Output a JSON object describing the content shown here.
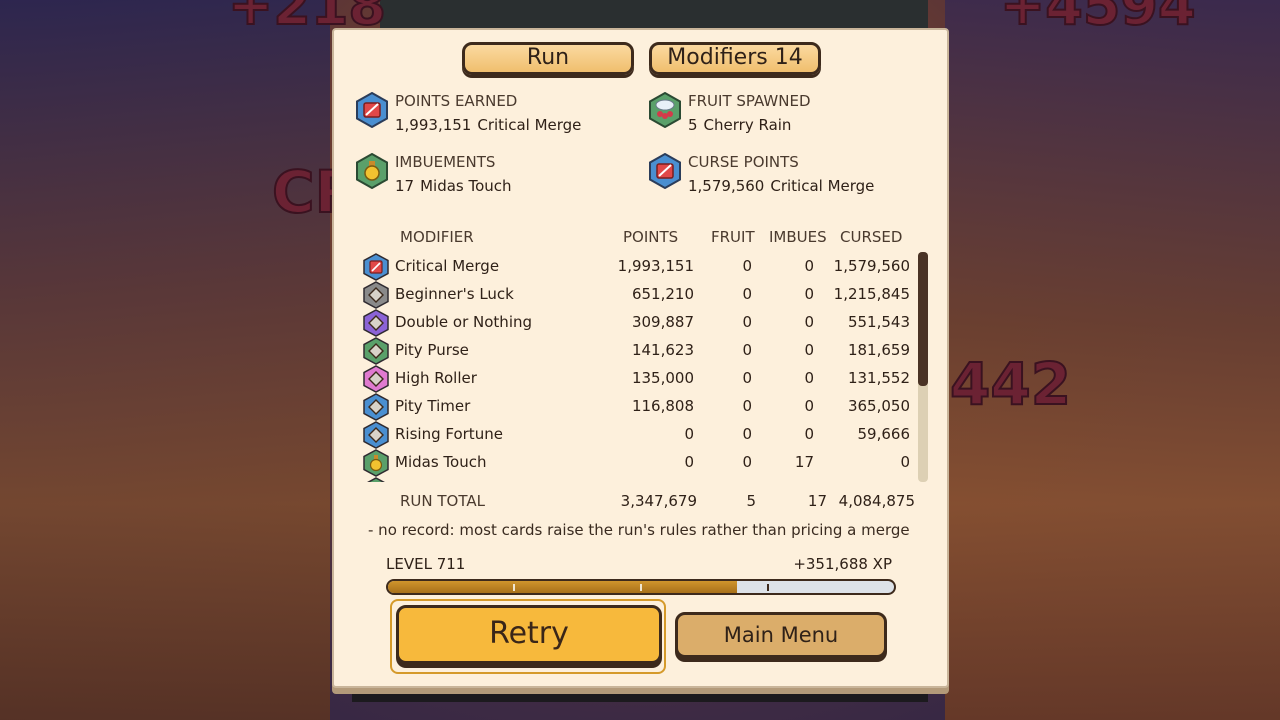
{
  "background": {
    "top_left_text": "+218",
    "top_right_text": "+4594",
    "left_text": "CR",
    "right_text": "442"
  },
  "tabs": {
    "run_label": "Run",
    "modifiers_label": "Modifiers  14"
  },
  "stats": {
    "points_earned": {
      "label": "POINTS EARNED",
      "value": "1,993,151",
      "source": "Critical Merge",
      "icon": "sword-blue-hex-icon"
    },
    "fruit_spawned": {
      "label": "FRUIT SPAWNED",
      "value": "5",
      "source": "Cherry Rain",
      "icon": "cherry-cloud-green-hex-icon"
    },
    "imbuements": {
      "label": "IMBUEMENTS",
      "value": "17",
      "source": "Midas Touch",
      "icon": "potion-green-hex-icon"
    },
    "curse_points": {
      "label": "CURSE POINTS",
      "value": "1,579,560",
      "source": "Critical Merge",
      "icon": "sword-blue-hex-icon"
    }
  },
  "table": {
    "headers": {
      "modifier": "MODIFIER",
      "points": "POINTS",
      "fruit": "FRUIT",
      "imbues": "IMBUES",
      "cursed": "CURSED"
    },
    "rows": [
      {
        "name": "Critical Merge",
        "points": "1,993,151",
        "fruit": "0",
        "imbues": "0",
        "cursed": "1,579,560",
        "icon": "sword-icon",
        "color": "#4a8fd1"
      },
      {
        "name": "Beginner's Luck",
        "points": "651,210",
        "fruit": "0",
        "imbues": "0",
        "cursed": "1,215,845",
        "icon": "diamond-icon",
        "color": "#8a8a8a"
      },
      {
        "name": "Double or Nothing",
        "points": "309,887",
        "fruit": "0",
        "imbues": "0",
        "cursed": "551,543",
        "icon": "diamond-icon",
        "color": "#8b63d6"
      },
      {
        "name": "Pity Purse",
        "points": "141,623",
        "fruit": "0",
        "imbues": "0",
        "cursed": "181,659",
        "icon": "diamond-icon",
        "color": "#5aa06a"
      },
      {
        "name": "High Roller",
        "points": "135,000",
        "fruit": "0",
        "imbues": "0",
        "cursed": "131,552",
        "icon": "diamond-icon",
        "color": "#e07ad0"
      },
      {
        "name": "Pity Timer",
        "points": "116,808",
        "fruit": "0",
        "imbues": "0",
        "cursed": "365,050",
        "icon": "diamond-icon",
        "color": "#4a8fd1"
      },
      {
        "name": "Rising Fortune",
        "points": "0",
        "fruit": "0",
        "imbues": "0",
        "cursed": "59,666",
        "icon": "diamond-icon",
        "color": "#4a8fd1"
      },
      {
        "name": "Midas Touch",
        "points": "0",
        "fruit": "0",
        "imbues": "17",
        "cursed": "0",
        "icon": "potion-icon",
        "color": "#5aa06a"
      },
      {
        "name": "",
        "points": "",
        "fruit": "",
        "imbues": "",
        "cursed": "",
        "icon": "diamond-icon",
        "color": "#5aa06a"
      }
    ],
    "scroll_position": 0
  },
  "totals": {
    "label": "RUN TOTAL",
    "points": "3,347,679",
    "fruit": "5",
    "imbues": "17",
    "cursed": "4,084,875"
  },
  "note": "-  no record: most cards raise the run's rules rather than pricing a merge",
  "level": {
    "label": "LEVEL 711",
    "xp_gain": "+351,688 XP",
    "progress": 0.69
  },
  "buttons": {
    "retry": "Retry",
    "main_menu": "Main Menu"
  },
  "colors": {
    "accent": "#f7b93c",
    "panel": "#fdf0dc",
    "outline": "#3d2a1c"
  }
}
